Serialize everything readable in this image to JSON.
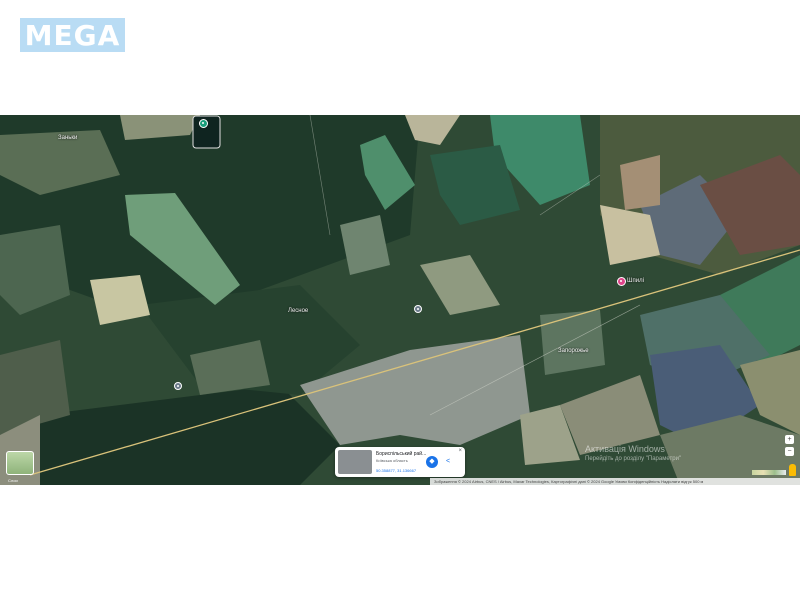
{
  "site": {
    "logo_text": "MEGA",
    "logo_color": "#b9dcf4"
  },
  "map": {
    "type": "satellite",
    "labels": {
      "top_left_village": "Заньки",
      "center_village": "Лесное",
      "right_village": "Запорожье",
      "right_small": "Шпилі"
    },
    "pins": [
      {
        "name": "lake-pin",
        "color": "#1a9e7b",
        "icon": "place-pin-icon"
      },
      {
        "name": "selected-pin",
        "color": "#e0458b",
        "icon": "place-pin-icon"
      },
      {
        "name": "gray-pin-center",
        "color": "#6b7a8a",
        "icon": "place-dot-icon"
      },
      {
        "name": "gray-pin-left",
        "color": "#6b7a8a",
        "icon": "place-dot-icon"
      }
    ],
    "layers_label": "Слои",
    "info_card": {
      "title": "Бориспільський рай...",
      "subtitle": "Київська область",
      "coords": "50.358877, 31.136667",
      "directions_icon": "directions-icon",
      "share_icon": "share-icon",
      "close_icon": "close-icon"
    },
    "watermark": {
      "title": "Активація Windows",
      "subtitle": "Перейдіть до розділу \"Параметри\""
    },
    "controls": {
      "zoom_in": "+",
      "zoom_out": "−"
    },
    "attribution": "Зображення © 2024 Airbus, CNES / Airbus, Maxar Technologies, Картографічні дані © 2024 Google   Умови   Конфіденційність   Надіслати відгук   500 м"
  }
}
